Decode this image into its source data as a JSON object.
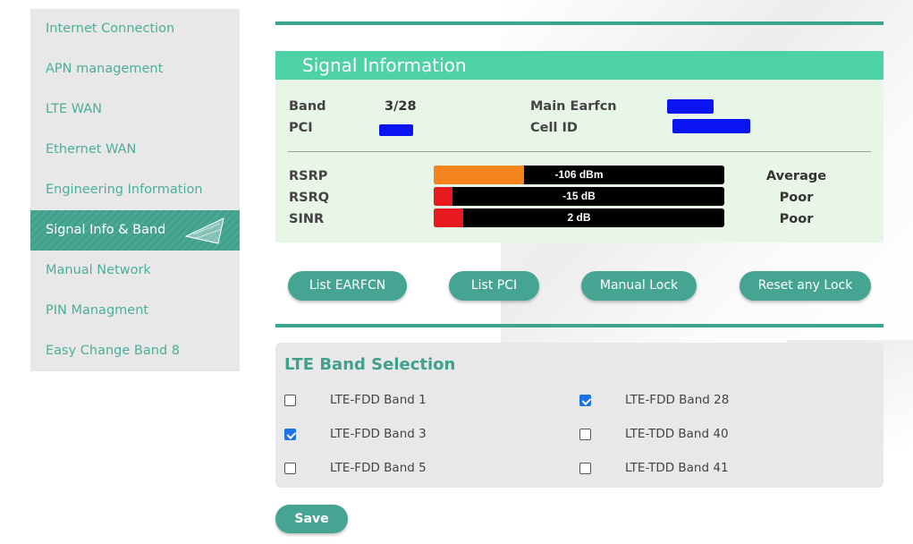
{
  "sidebar": {
    "items": [
      {
        "label": "Internet Connection"
      },
      {
        "label": "APN management"
      },
      {
        "label": "LTE WAN"
      },
      {
        "label": "Ethernet WAN"
      },
      {
        "label": "Engineering Information"
      },
      {
        "label": "Signal Info & Band",
        "active": true
      },
      {
        "label": "Manual Network"
      },
      {
        "label": "PIN Managment"
      },
      {
        "label": "Easy Change Band 8"
      }
    ]
  },
  "signal": {
    "title": "Signal Information",
    "band_label": "Band",
    "band_value": "3/28",
    "pci_label": "PCI",
    "main_earfcn_label": "Main Earfcn",
    "cell_id_label": "Cell ID",
    "metrics": [
      {
        "label": "RSRP",
        "value": "-106 dBm",
        "quality": "Average",
        "fill_fraction": 0.31,
        "color": "#f5841f"
      },
      {
        "label": "RSRQ",
        "value": "-15 dB",
        "quality": "Poor",
        "fill_fraction": 0.065,
        "color": "#e8191e"
      },
      {
        "label": "SINR",
        "value": "2 dB",
        "quality": "Poor",
        "fill_fraction": 0.1,
        "color": "#e8191e"
      }
    ]
  },
  "actions": {
    "list_earfcn": "List EARFCN",
    "list_pci": "List PCI",
    "manual_lock": "Manual Lock",
    "reset_lock": "Reset any Lock"
  },
  "bands": {
    "title": "LTE Band Selection",
    "items": [
      {
        "label": "LTE-FDD Band 1",
        "checked": false
      },
      {
        "label": "LTE-FDD Band 3",
        "checked": true
      },
      {
        "label": "LTE-FDD Band 5",
        "checked": false
      },
      {
        "label": "LTE-FDD Band 28",
        "checked": true
      },
      {
        "label": "LTE-TDD Band 40",
        "checked": false
      },
      {
        "label": "LTE-TDD Band 41",
        "checked": false
      }
    ],
    "save_label": "Save"
  },
  "colors": {
    "accent": "#3fa08c",
    "header": "#4fd1a8",
    "panel_bg": "#e8f6e7",
    "redaction": "#0a14f0"
  }
}
